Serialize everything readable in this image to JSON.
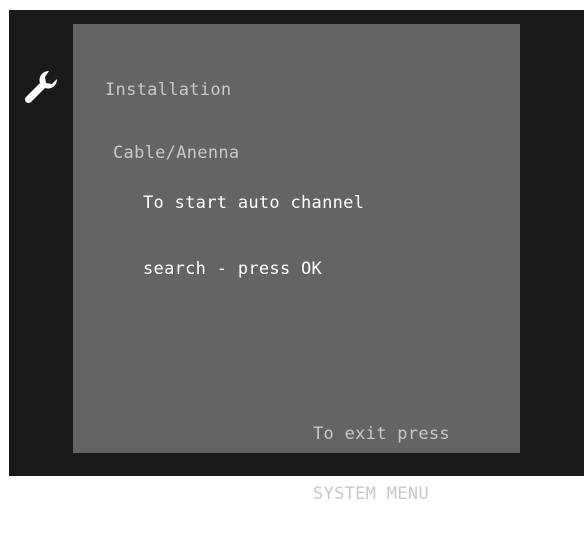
{
  "menu": {
    "icon": "wrench-icon",
    "title_line1": "Installation",
    "title_line2": "Cable/Anenna"
  },
  "message": {
    "line1": "To start auto channel",
    "line2": "search - press OK"
  },
  "exit_hint": {
    "line1": "To exit press",
    "line2": "SYSTEM MENU"
  },
  "colors": {
    "screen_background": "#1a1a1a",
    "panel_background": "#646464",
    "title_text": "#c9c9c9",
    "message_text": "#ffffff"
  }
}
